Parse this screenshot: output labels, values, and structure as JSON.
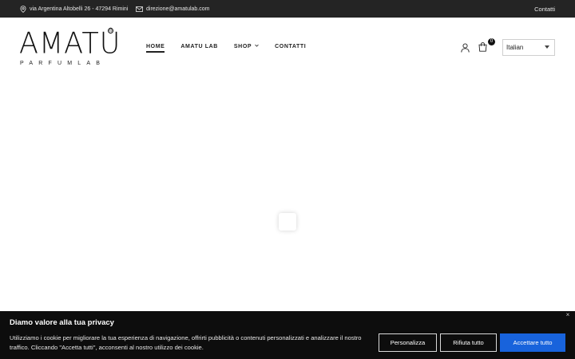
{
  "topbar": {
    "address": "via Argentina Altobelli 26 - 47294 Rimini",
    "email": "direzione@amatulab.com",
    "contacts_link": "Contatti",
    "address_icon": "map-pin-icon",
    "email_icon": "envelope-icon"
  },
  "header": {
    "logo_word": "AMATU",
    "logo_sub": "PARFUMLAB",
    "logo_mark": "®",
    "nav": [
      {
        "label": "HOME",
        "active": true
      },
      {
        "label": "AMATU LAB",
        "active": false
      },
      {
        "label": "SHOP",
        "active": false,
        "dropdown": true
      },
      {
        "label": "CONTATTI",
        "active": false
      }
    ],
    "cart_count": "0",
    "language": "Italian"
  },
  "cookie": {
    "title": "Diamo valore alla tua privacy",
    "text": "Utilizziamo i cookie per migliorare la tua esperienza di navigazione, offrirti pubblicità o contenuti personalizzati e analizzare il nostro traffico. Cliccando \"Accetta tutti\", acconsenti al nostro utilizzo dei cookie.",
    "customize_label": "Personalizza",
    "reject_label": "Rifiuta tutto",
    "accept_label": "Accettare tutto",
    "close_label": "×",
    "accent": "#1863dc"
  }
}
